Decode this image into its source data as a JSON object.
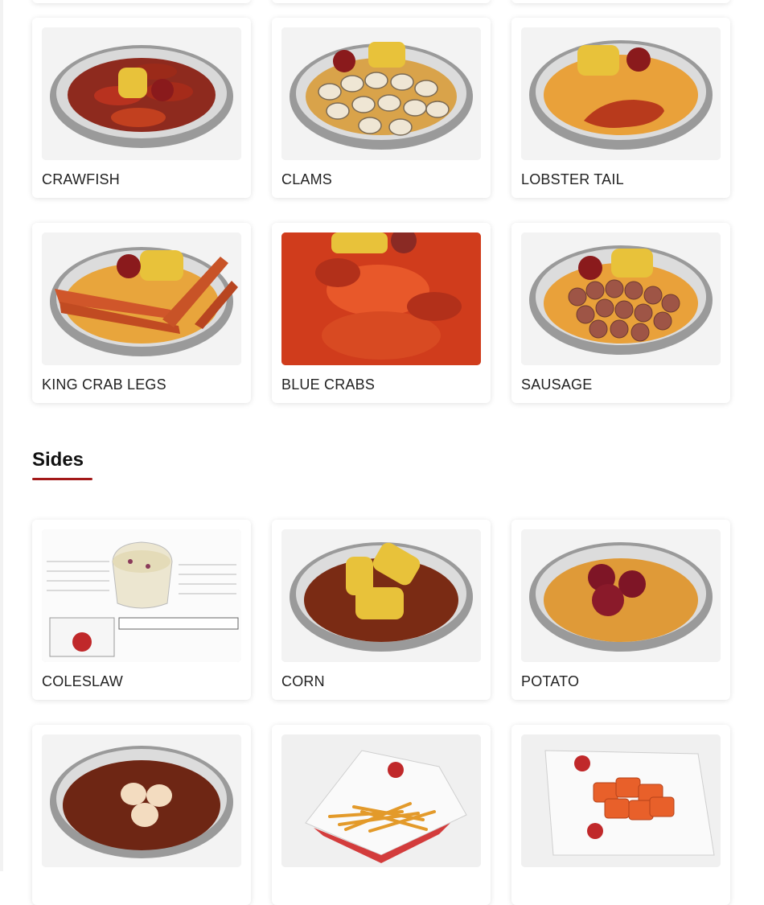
{
  "seafood": {
    "items": [
      {
        "label": "CRAWFISH",
        "icon": "crawfish-plate-image"
      },
      {
        "label": "CLAMS",
        "icon": "clams-plate-image"
      },
      {
        "label": "LOBSTER TAIL",
        "icon": "lobster-tail-plate-image"
      },
      {
        "label": "KING CRAB LEGS",
        "icon": "king-crab-legs-plate-image"
      },
      {
        "label": "BLUE CRABS",
        "icon": "blue-crabs-plate-image"
      },
      {
        "label": "SAUSAGE",
        "icon": "sausage-plate-image"
      }
    ]
  },
  "sides": {
    "title": "Sides",
    "items": [
      {
        "label": "COLESLAW",
        "icon": "coleslaw-image"
      },
      {
        "label": "CORN",
        "icon": "corn-plate-image"
      },
      {
        "label": "POTATO",
        "icon": "potato-plate-image"
      },
      {
        "label": "",
        "icon": "eggs-plate-image"
      },
      {
        "label": "",
        "icon": "fries-basket-image"
      },
      {
        "label": "",
        "icon": "waffle-fries-basket-image"
      }
    ]
  },
  "colors": {
    "accent": "#a31919",
    "card_background": "#ffffff",
    "label_text": "#222222"
  }
}
